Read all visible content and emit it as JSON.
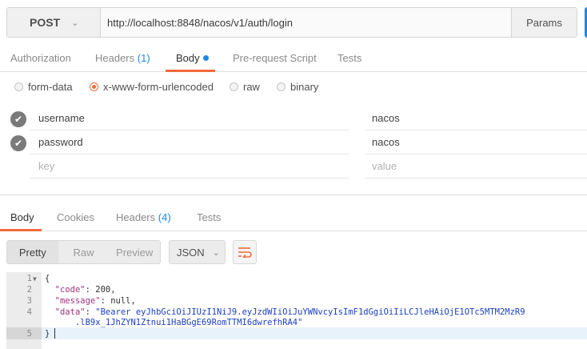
{
  "request": {
    "method": "POST",
    "url": "http://localhost:8848/nacos/v1/auth/login",
    "params_label": "Params"
  },
  "request_tabs": {
    "authorization": "Authorization",
    "headers": "Headers",
    "headers_count": "(1)",
    "body": "Body",
    "prerequest": "Pre-request Script",
    "tests": "Tests"
  },
  "body_modes": {
    "form_data": "form-data",
    "urlencoded": "x-www-form-urlencoded",
    "raw": "raw",
    "binary": "binary",
    "selected": "x-www-form-urlencoded"
  },
  "params": {
    "rows": [
      {
        "key": "username",
        "value": "nacos",
        "enabled": true
      },
      {
        "key": "password",
        "value": "nacos",
        "enabled": true
      }
    ],
    "key_placeholder": "key",
    "value_placeholder": "value"
  },
  "response_tabs": {
    "body": "Body",
    "cookies": "Cookies",
    "headers": "Headers",
    "headers_count": "(4)",
    "tests": "Tests"
  },
  "response_view": {
    "pretty": "Pretty",
    "raw": "Raw",
    "preview": "Preview",
    "format": "JSON"
  },
  "response_body": {
    "line_numbers": [
      "1",
      "2",
      "3",
      "4",
      "5"
    ],
    "open_brace": "{",
    "close_brace": "}",
    "code_key": "\"code\"",
    "code_value": "200,",
    "message_key": "\"message\"",
    "message_value": "null,",
    "data_key": "\"data\"",
    "data_value_1": "\"Bearer eyJhbGciOiJIUzI1NiJ9.eyJzdWIiOiJuYWNvcyIsImF1dGgiOiIiLCJleHAiOjE1OTc5MTM2MzR9",
    "data_value_2": ".lB9x_1JhZYN1Ztnui1HaBGgE69RomTTMI6dwrefhRA4\""
  },
  "colors": {
    "accent": "#f26b3a",
    "link": "#1e88e5"
  }
}
